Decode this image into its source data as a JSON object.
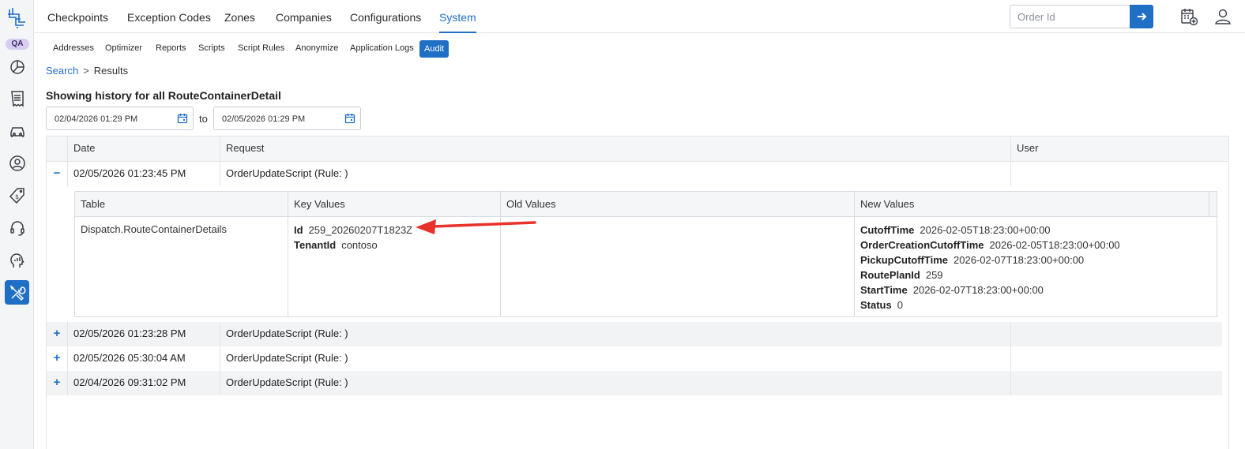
{
  "env_badge": "QA",
  "top_tabs": [
    {
      "label": "Checkpoints"
    },
    {
      "label": "Exception Codes"
    },
    {
      "label": "Zones"
    },
    {
      "label": "Companies"
    },
    {
      "label": "Configurations"
    },
    {
      "label": "System",
      "active": true
    }
  ],
  "order_search": {
    "placeholder": "Order Id",
    "value": ""
  },
  "sub_tabs": [
    {
      "label": "Addresses"
    },
    {
      "label": "Optimizer"
    },
    {
      "label": "Reports"
    },
    {
      "label": "Scripts"
    },
    {
      "label": "Script Rules"
    },
    {
      "label": "Anonymize"
    },
    {
      "label": "Application Logs"
    },
    {
      "label": "Audit",
      "active": true
    }
  ],
  "breadcrumb": {
    "link": "Search",
    "separator": ">",
    "current": "Results"
  },
  "heading": "Showing history for all RouteContainerDetail",
  "date_range": {
    "from": "02/04/2026 01:29 PM",
    "to_label": "to",
    "to": "02/05/2026 01:29 PM"
  },
  "table": {
    "columns": [
      "Date",
      "Request",
      "User"
    ],
    "rows": [
      {
        "toggle": "−",
        "date": "02/05/2026 01:23:45 PM",
        "request": "OrderUpdateScript (Rule: )",
        "user": "",
        "expanded": true
      },
      {
        "toggle": "+",
        "date": "02/05/2026 01:23:28 PM",
        "request": "OrderUpdateScript (Rule: )",
        "user": ""
      },
      {
        "toggle": "+",
        "date": "02/05/2026 05:30:04 AM",
        "request": "OrderUpdateScript (Rule: )",
        "user": ""
      },
      {
        "toggle": "+",
        "date": "02/04/2026 09:31:02 PM",
        "request": "OrderUpdateScript (Rule: )",
        "user": ""
      }
    ]
  },
  "detail": {
    "columns": [
      "Table",
      "Key Values",
      "Old Values",
      "New Values"
    ],
    "table_name": "Dispatch.RouteContainerDetails",
    "key_values": [
      {
        "key": "Id",
        "value": "259_20260207T1823Z"
      },
      {
        "key": "TenantId",
        "value": "contoso"
      }
    ],
    "new_values": [
      {
        "key": "CutoffTime",
        "value": "2026-02-05T18:23:00+00:00"
      },
      {
        "key": "OrderCreationCutoffTime",
        "value": "2026-02-05T18:23:00+00:00"
      },
      {
        "key": "PickupCutoffTime",
        "value": "2026-02-07T18:23:00+00:00"
      },
      {
        "key": "RoutePlanId",
        "value": "259"
      },
      {
        "key": "StartTime",
        "value": "2026-02-07T18:23:00+00:00"
      },
      {
        "key": "Status",
        "value": "0"
      }
    ]
  },
  "colors": {
    "accent": "#1f6fc5",
    "annotation_arrow": "#e8322a"
  }
}
